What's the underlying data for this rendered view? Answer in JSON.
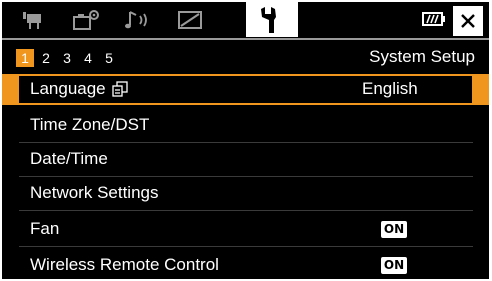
{
  "tabs": [
    {
      "icon": "movie-camera-icon"
    },
    {
      "icon": "camera-settings-icon"
    },
    {
      "icon": "audio-icon"
    },
    {
      "icon": "display-icon"
    },
    {
      "icon": "wrench-icon",
      "active": true
    }
  ],
  "status": {
    "battery_icon": "battery-icon",
    "close_icon": "close-icon"
  },
  "pagination": {
    "pages": [
      "1",
      "2",
      "3",
      "4",
      "5"
    ],
    "current": "1"
  },
  "section_title": "System Setup",
  "menu": [
    {
      "label": "Language",
      "value": "English",
      "selected": true,
      "icon": "language-icon"
    },
    {
      "label": "Time Zone/DST",
      "value": ""
    },
    {
      "label": "Date/Time",
      "value": ""
    },
    {
      "label": "Network Settings",
      "value": ""
    },
    {
      "label": "Fan",
      "value": "ON"
    },
    {
      "label": "Wireless Remote Control",
      "value": "ON"
    }
  ],
  "colors": {
    "accent": "#f0961e",
    "background": "#000000",
    "text": "#ffffff"
  }
}
